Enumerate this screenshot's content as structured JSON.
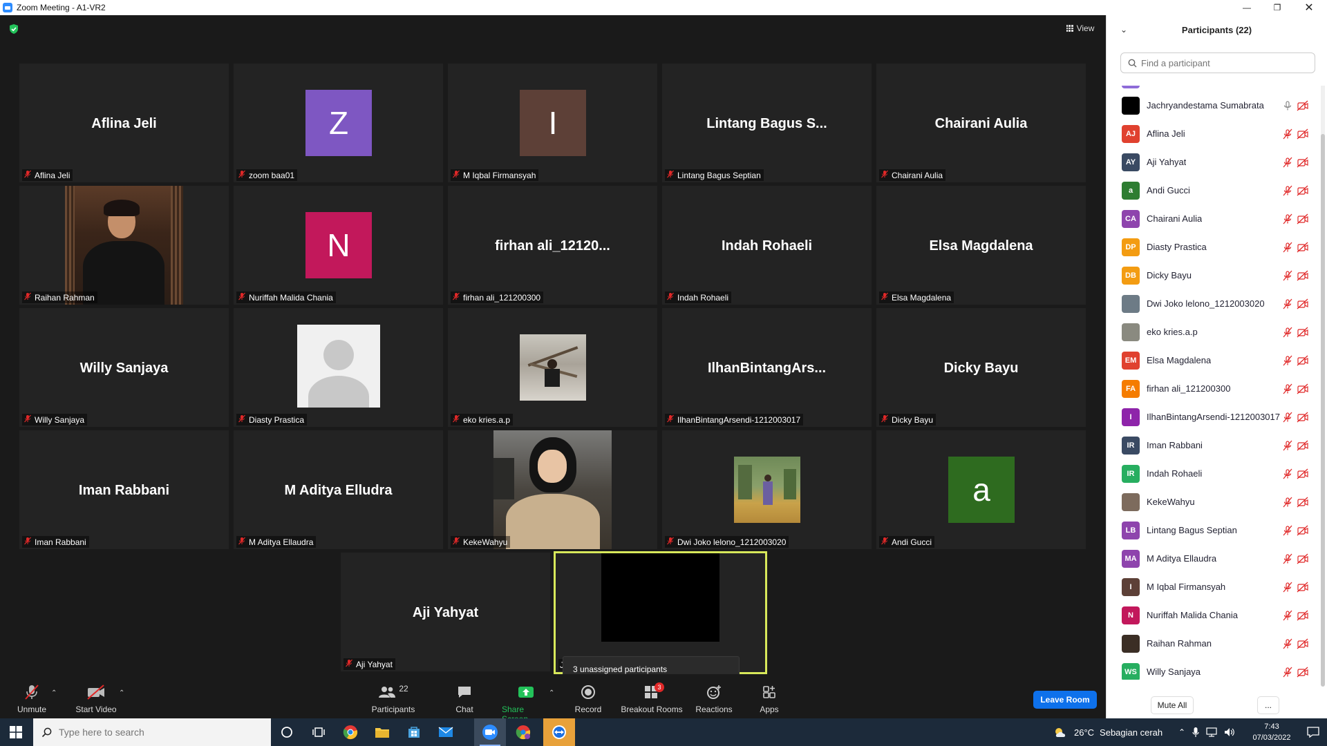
{
  "window": {
    "title": "Zoom Meeting - A1-VR2"
  },
  "meeting": {
    "view_label": "View",
    "tiles": [
      {
        "big": "Aflina Jeli",
        "label": "Aflina Jeli",
        "kind": "text"
      },
      {
        "big": "Z",
        "label": "zoom baa01",
        "kind": "avatar",
        "color": "#7e57c2"
      },
      {
        "big": "I",
        "label": "M Iqbal Firmansyah",
        "kind": "avatar",
        "color": "#5d4037"
      },
      {
        "big": "Lintang Bagus S...",
        "label": "Lintang Bagus Septian",
        "kind": "text"
      },
      {
        "big": "Chairani Aulia",
        "label": "Chairani Aulia",
        "kind": "text"
      },
      {
        "big": "",
        "label": "Raihan Rahman",
        "kind": "photo"
      },
      {
        "big": "N",
        "label": "Nuriffah Malida Chania",
        "kind": "avatar",
        "color": "#c2185b"
      },
      {
        "big": "firhan  ali_12120...",
        "label": "firhan ali_121200300",
        "kind": "text"
      },
      {
        "big": "Indah Rohaeli",
        "label": "Indah Rohaeli",
        "kind": "text"
      },
      {
        "big": "Elsa Magdalena",
        "label": "Elsa Magdalena",
        "kind": "text"
      },
      {
        "big": "Willy Sanjaya",
        "label": "Willy Sanjaya",
        "kind": "text"
      },
      {
        "big": "",
        "label": "Diasty Prastica",
        "kind": "default-avatar"
      },
      {
        "big": "",
        "label": "eko kries.a.p",
        "kind": "photo-small"
      },
      {
        "big": "IlhanBintangArs...",
        "label": "IlhanBintangArsendi-1212003017",
        "kind": "text"
      },
      {
        "big": "Dicky Bayu",
        "label": "Dicky Bayu",
        "kind": "text"
      },
      {
        "big": "Iman Rabbani",
        "label": "Iman Rabbani",
        "kind": "text"
      },
      {
        "big": "M Aditya Elludra",
        "label": "M Aditya Ellaudra",
        "kind": "text"
      },
      {
        "big": "",
        "label": "KekeWahyu",
        "kind": "photo-portrait"
      },
      {
        "big": "",
        "label": "Dwi Joko lelono_1212003020",
        "kind": "photo-small2"
      },
      {
        "big": "a",
        "label": "Andi Gucci",
        "kind": "avatar",
        "color": "#2e6b1f"
      },
      {
        "big": "Aji Yahyat",
        "label": "Aji Yahyat",
        "kind": "text"
      },
      {
        "big": "",
        "label": "J",
        "kind": "self"
      }
    ],
    "tooltip": "3 unassigned participants"
  },
  "toolbar": {
    "unmute": "Unmute",
    "start_video": "Start Video",
    "participants": "Participants",
    "participants_count": "22",
    "chat": "Chat",
    "share_screen": "Share Screen",
    "record": "Record",
    "breakout_rooms": "Breakout Rooms",
    "breakout_badge": "3",
    "reactions": "Reactions",
    "apps": "Apps",
    "leave": "Leave Room"
  },
  "panel": {
    "title": "Participants (22)",
    "search_placeholder": "Find a participant",
    "participants": [
      {
        "name": "Jachryandestama Sumabrata",
        "initials": "",
        "color": "#000000",
        "mic_on": true
      },
      {
        "name": "Aflina Jeli",
        "initials": "AJ",
        "color": "#e0412f"
      },
      {
        "name": "Aji Yahyat",
        "initials": "AY",
        "color": "#3a4a63"
      },
      {
        "name": "Andi Gucci",
        "initials": "a",
        "color": "#2e7d32"
      },
      {
        "name": "Chairani Aulia",
        "initials": "CA",
        "color": "#8e44ad"
      },
      {
        "name": "Diasty Prastica",
        "initials": "DP",
        "color": "#f39c12"
      },
      {
        "name": "Dicky Bayu",
        "initials": "DB",
        "color": "#f39c12"
      },
      {
        "name": "Dwi Joko lelono_1212003020",
        "initials": "",
        "color": "#6d7b86"
      },
      {
        "name": "eko kries.a.p",
        "initials": "",
        "color": "#8a8a80"
      },
      {
        "name": "Elsa Magdalena",
        "initials": "EM",
        "color": "#e0412f"
      },
      {
        "name": "firhan ali_121200300",
        "initials": "FA",
        "color": "#f57c00"
      },
      {
        "name": "IlhanBintangArsendi-1212003017",
        "initials": "I",
        "color": "#8e24aa"
      },
      {
        "name": "Iman Rabbani",
        "initials": "IR",
        "color": "#3a4a63"
      },
      {
        "name": "Indah Rohaeli",
        "initials": "IR",
        "color": "#27ae60"
      },
      {
        "name": "KekeWahyu",
        "initials": "",
        "color": "#7d6b5d"
      },
      {
        "name": "Lintang Bagus Septian",
        "initials": "LB",
        "color": "#8e44ad"
      },
      {
        "name": "M Aditya Ellaudra",
        "initials": "MA",
        "color": "#8e44ad"
      },
      {
        "name": "M Iqbal Firmansyah",
        "initials": "I",
        "color": "#5d4037"
      },
      {
        "name": "Nuriffah Malida Chania",
        "initials": "N",
        "color": "#c2185b"
      },
      {
        "name": "Raihan Rahman",
        "initials": "",
        "color": "#3b2e25"
      },
      {
        "name": "Willy Sanjaya",
        "initials": "WS",
        "color": "#27ae60"
      }
    ],
    "mute_all": "Mute All",
    "more": "..."
  },
  "taskbar": {
    "search_placeholder": "Type here to search",
    "weather_temp": "26°C",
    "weather_desc": "Sebagian cerah",
    "time": "7:43",
    "date": "07/03/2022"
  }
}
